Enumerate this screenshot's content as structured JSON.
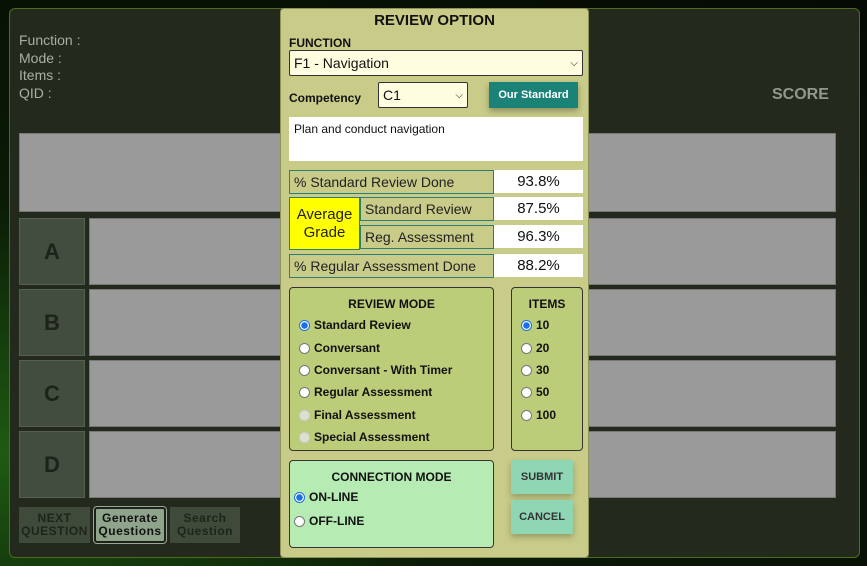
{
  "info": {
    "function": "Function :",
    "mode": "Mode :",
    "items": "Items :",
    "qid": "QID  :"
  },
  "score_label": "SCORE",
  "answers": [
    "A",
    "B",
    "C",
    "D"
  ],
  "buttons": {
    "next": "NEXT QUESTION",
    "generate": "Generate Questions",
    "search": "Search Question"
  },
  "modal": {
    "title": "REVIEW OPTION",
    "function_label": "FUNCTION",
    "function_value": "F1 - Navigation",
    "competency_label": "Competency",
    "competency_value": "C1",
    "our_standard": "Our Standard",
    "description": "Plan and conduct navigation",
    "stats": {
      "std_done_label": "% Standard Review Done",
      "std_done": "93.8%",
      "avg_grade_label": "Average Grade",
      "std_review_label": "Standard Review",
      "std_review": "87.5%",
      "reg_assess_label": "Reg. Assessment",
      "reg_assess": "96.3%",
      "reg_done_label": "% Regular Assessment Done",
      "reg_done": "88.2%"
    },
    "review_mode": {
      "title": "REVIEW MODE",
      "options": [
        "Standard Review",
        "Conversant",
        "Conversant - With Timer",
        "Regular Assessment",
        "Final Assessment",
        "Special Assessment"
      ],
      "selected": "Standard Review",
      "disabled": [
        "Final Assessment",
        "Special Assessment"
      ]
    },
    "items": {
      "title": "ITEMS",
      "options": [
        "10",
        "20",
        "30",
        "50",
        "100"
      ],
      "selected": "10"
    },
    "connection": {
      "title": "CONNECTION MODE",
      "options": [
        "ON-LINE",
        "OFF-LINE"
      ],
      "selected": "ON-LINE"
    },
    "submit": "SUBMIT",
    "cancel": "CANCEL"
  }
}
